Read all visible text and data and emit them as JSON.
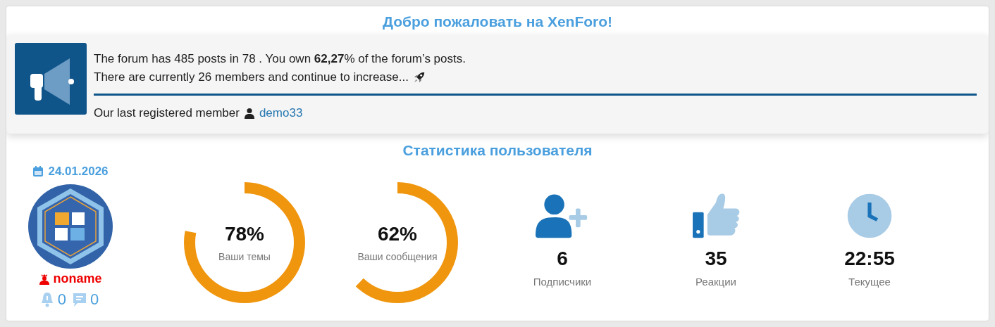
{
  "welcome": {
    "title": "Добро пожаловать на XenForo!",
    "line_1": "The forum has 485 posts in 78 . You own **62,27**% of the forum’s posts.",
    "line_2": "There are currently 26 members and continue to increase...",
    "last_member_label": "Our last registered member",
    "last_member": "demo33"
  },
  "stats": {
    "title": "Статистика пользователя",
    "date": "24.01.2026",
    "username": "noname",
    "alerts": "0",
    "messages": "0",
    "rings": [
      {
        "value": "78%",
        "label": "Ваши темы",
        "level": 0.78
      },
      {
        "value": "62%",
        "label": "Ваши сообщения",
        "level": 0.62
      }
    ],
    "counters": [
      {
        "kind": "followers",
        "value": "6",
        "label": "Подписчики"
      },
      {
        "kind": "reactions",
        "value": "35",
        "label": "Реакции"
      },
      {
        "kind": "time",
        "value": "22:55",
        "label": "Текущее"
      }
    ]
  }
}
